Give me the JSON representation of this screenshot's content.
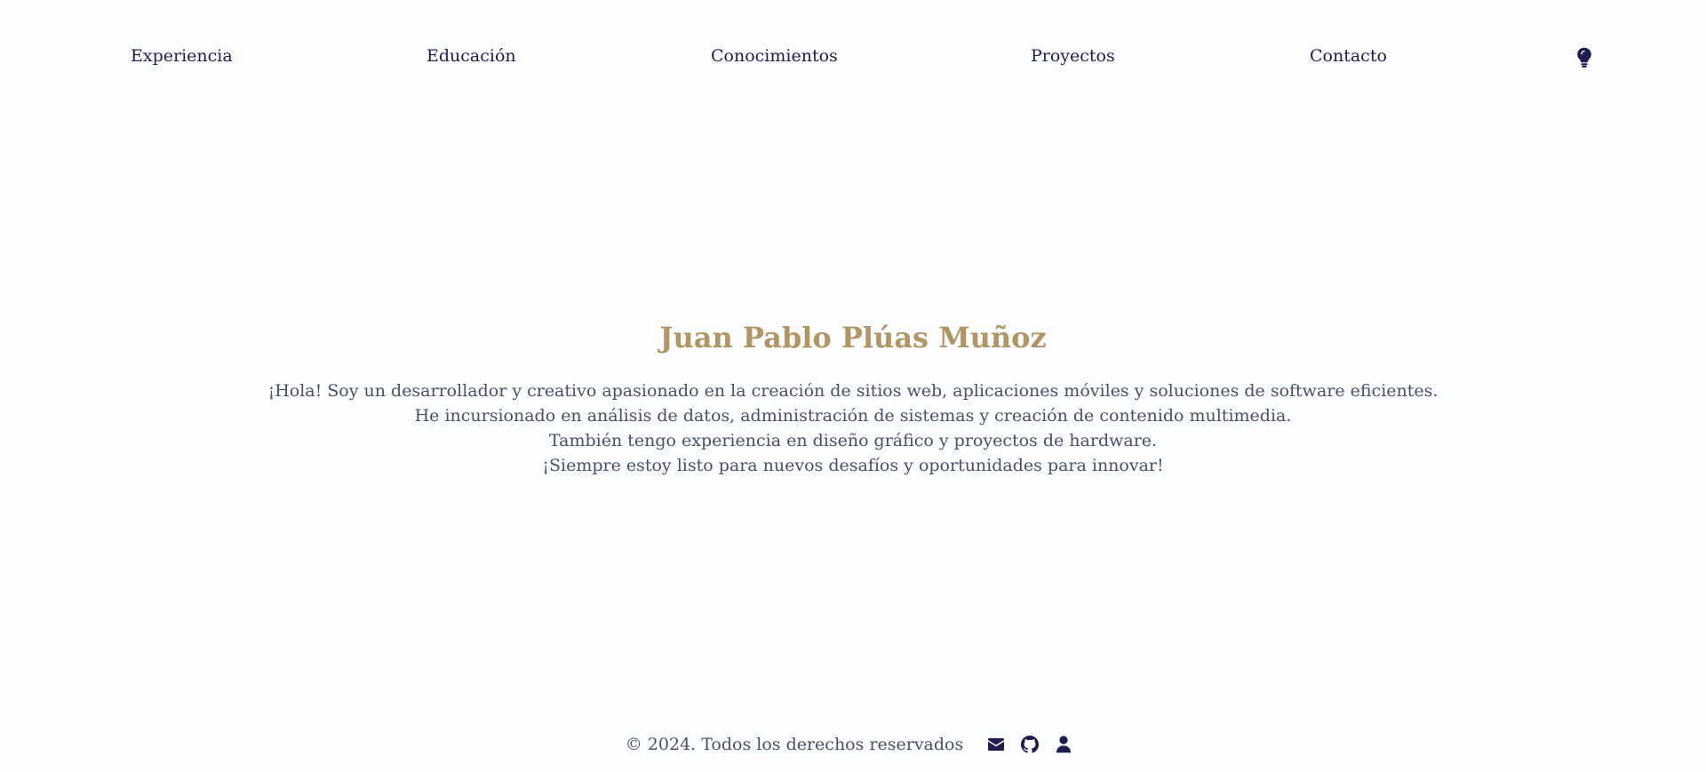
{
  "nav": {
    "items": [
      {
        "label": "Experiencia"
      },
      {
        "label": "Educación"
      },
      {
        "label": "Conocimientos"
      },
      {
        "label": "Proyectos"
      },
      {
        "label": "Contacto"
      }
    ],
    "theme_toggle_icon": "lightbulb-icon"
  },
  "hero": {
    "name": "Juan Pablo Plúas Muñoz",
    "bio_lines": [
      "¡Hola! Soy un desarrollador y creativo apasionado en la creación de sitios web, aplicaciones móviles y soluciones de software eficientes.",
      "He incursionado en análisis de datos, administración de sistemas y creación de contenido multimedia.",
      "También tengo experiencia en diseño gráfico y proyectos de hardware.",
      "¡Siempre estoy listo para nuevos desafíos y oportunidades para innovar!"
    ]
  },
  "footer": {
    "copyright": "© 2024. Todos los derechos reservados",
    "social_icons": [
      "envelope-icon",
      "github-icon",
      "user-icon"
    ]
  },
  "colors": {
    "background": "#fbfdfe",
    "primary": "#1d1d52",
    "accent": "#b19562",
    "text": "#4b4f6a"
  }
}
